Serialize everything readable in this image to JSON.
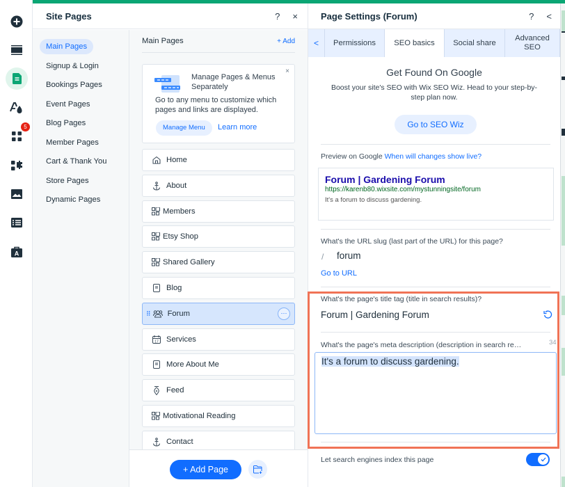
{
  "rail": {
    "items": [
      {
        "icon": "add-icon",
        "active": false
      },
      {
        "icon": "sections-icon",
        "active": false
      },
      {
        "icon": "pages-icon",
        "active": true
      },
      {
        "icon": "design-icon",
        "active": false
      },
      {
        "icon": "apps-icon",
        "active": false,
        "badge": "5"
      },
      {
        "icon": "business-apps-icon",
        "active": false
      },
      {
        "icon": "media-icon",
        "active": false
      },
      {
        "icon": "cms-icon",
        "active": false
      },
      {
        "icon": "portfolio-icon",
        "active": false
      }
    ]
  },
  "colors": {
    "accent": "#116dff",
    "brand_green": "#0aa674",
    "highlight": "#f07356",
    "badge": "#e62214"
  },
  "site_pages": {
    "title": "Site Pages",
    "help": "?",
    "close": "×",
    "categories": [
      {
        "label": "Main Pages",
        "active": true
      },
      {
        "label": "Signup & Login"
      },
      {
        "label": "Bookings Pages"
      },
      {
        "label": "Event Pages"
      },
      {
        "label": "Blog Pages"
      },
      {
        "label": "Member Pages"
      },
      {
        "label": "Cart & Thank You"
      },
      {
        "label": "Store Pages"
      },
      {
        "label": "Dynamic Pages"
      }
    ],
    "section_title": "Main Pages",
    "add_label": "+ Add",
    "promo": {
      "title": "Manage Pages & Menus Separately",
      "text": "Go to any menu to customize which pages and links are displayed.",
      "button": "Manage Menu",
      "link": "Learn more",
      "close": "×"
    },
    "pages": [
      {
        "label": "Home",
        "icon": "home-icon"
      },
      {
        "label": "About",
        "icon": "anchor-icon"
      },
      {
        "label": "Members",
        "icon": "app-icon"
      },
      {
        "label": "Etsy Shop",
        "icon": "app-icon"
      },
      {
        "label": "Shared Gallery",
        "icon": "app-icon"
      },
      {
        "label": "Blog",
        "icon": "blog-icon"
      },
      {
        "label": "Forum",
        "icon": "forum-icon",
        "selected": true
      },
      {
        "label": "Services",
        "icon": "calendar-icon"
      },
      {
        "label": "More About Me",
        "icon": "blog-icon"
      },
      {
        "label": "Feed",
        "icon": "feed-icon"
      },
      {
        "label": "Motivational Reading",
        "icon": "app-icon"
      },
      {
        "label": "Contact",
        "icon": "anchor-icon"
      }
    ],
    "more_label": "···",
    "add_page": "+ Add Page"
  },
  "page_settings": {
    "title": "Page Settings (Forum)",
    "help": "?",
    "back": "<",
    "tabs": [
      {
        "label": "Permissions"
      },
      {
        "label": "SEO basics",
        "active": true
      },
      {
        "label": "Social share"
      },
      {
        "label": "Advanced SEO"
      }
    ],
    "tab_back": "<",
    "seo_wiz": {
      "title": "Get Found On Google",
      "text": "Boost your site's SEO with Wix SEO Wiz. Head to your step-by-step plan now.",
      "button": "Go to SEO Wiz"
    },
    "preview": {
      "label": "Preview on Google",
      "link": "When will changes show live?",
      "title": "Forum | Gardening Forum",
      "url": "https://karenb80.wixsite.com/mystunningsite/forum",
      "desc": "It's a forum to discuss gardening."
    },
    "slug": {
      "label": "What's the URL slug (last part of the URL) for this page?",
      "separator": "/",
      "value": "forum",
      "link": "Go to URL"
    },
    "title_tag": {
      "label": "What's the page's title tag (title in search results)?",
      "value": "Forum | Gardening Forum"
    },
    "meta": {
      "label": "What's the page's meta description (description in search re…",
      "count": "34",
      "value": "It's a forum to discuss gardening."
    },
    "index": {
      "label": "Let search engines index this page",
      "enabled": true
    }
  }
}
